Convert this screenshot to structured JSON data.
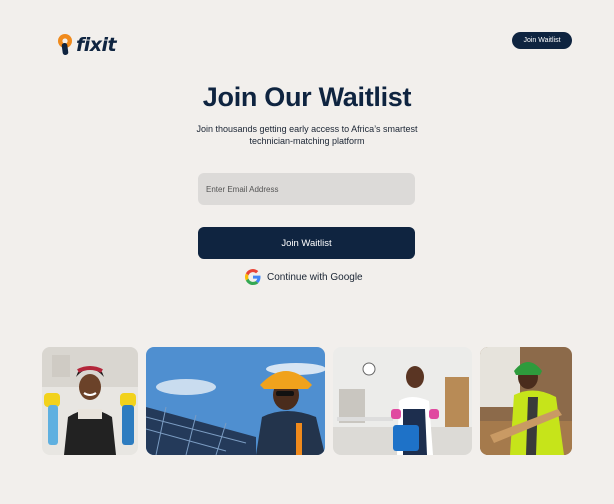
{
  "brand": {
    "name": "fixit",
    "accent": "#f08a1c",
    "primary": "#0f2440"
  },
  "nav": {
    "cta_label": "Join Waitlist"
  },
  "hero": {
    "title": "Join Our Waitlist",
    "subtitle": "Join thousands getting early access to Africa’s smartest technician-matching platform"
  },
  "form": {
    "email_placeholder": "Enter Email Address",
    "submit_label": "Join Waitlist",
    "google_label": "Continue with Google",
    "google_icon": "google-g-icon"
  },
  "gallery": {
    "images": [
      "cleaner-photo",
      "solar-technician-photo",
      "office-cleaner-photo",
      "carpenter-photo"
    ]
  }
}
